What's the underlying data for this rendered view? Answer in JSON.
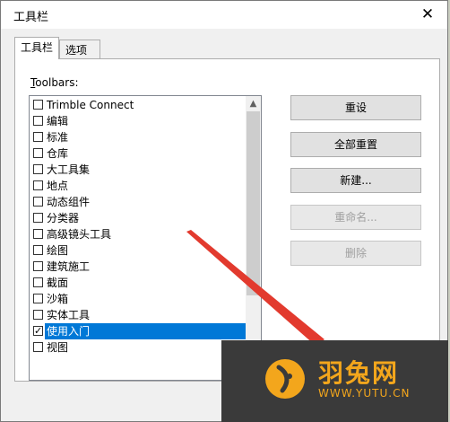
{
  "window": {
    "title": "工具栏",
    "close_label": "✕"
  },
  "tabs": [
    {
      "label": "工具栏"
    },
    {
      "label": "选项"
    }
  ],
  "toolbars_label": {
    "accel": "T",
    "rest": "oolbars:"
  },
  "toolbar_items": [
    {
      "label": "Trimble Connect",
      "checked": false
    },
    {
      "label": "编辑",
      "checked": false
    },
    {
      "label": "标准",
      "checked": false
    },
    {
      "label": "仓库",
      "checked": false
    },
    {
      "label": "大工具集",
      "checked": false
    },
    {
      "label": "地点",
      "checked": false
    },
    {
      "label": "动态组件",
      "checked": false
    },
    {
      "label": "分类器",
      "checked": false
    },
    {
      "label": "高级镜头工具",
      "checked": false
    },
    {
      "label": "绘图",
      "checked": false
    },
    {
      "label": "建筑施工",
      "checked": false
    },
    {
      "label": "截面",
      "checked": false
    },
    {
      "label": "沙箱",
      "checked": false
    },
    {
      "label": "实体工具",
      "checked": false
    },
    {
      "label": "使用入门",
      "checked": true,
      "selected": true
    },
    {
      "label": "视图",
      "checked": false
    }
  ],
  "buttons": {
    "reset": "重设",
    "reset_all": "全部重置",
    "new": "新建...",
    "rename": "重命名...",
    "delete": "删除"
  },
  "watermark": {
    "name": "羽兔网",
    "url": "WWW.YUTU.CN",
    "color": "#f3a61c"
  }
}
